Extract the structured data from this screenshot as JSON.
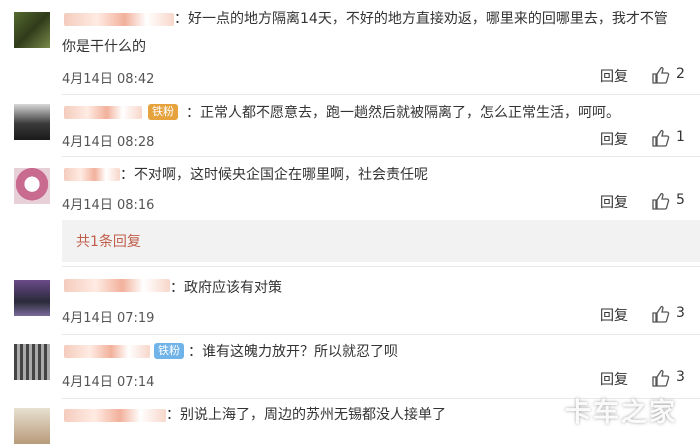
{
  "comments": [
    {
      "text_line1": "：好一点的地方隔离14天，不好的地方直接劝返，哪里来的回哪里去，我才不管",
      "text_line2": "你是干什么的",
      "date": "4月14日 08:42",
      "reply_label": "回复",
      "likes": "2"
    },
    {
      "badge": "铁粉",
      "text": "：正常人都不愿意去，跑一趟然后就被隔离了，怎么正常生活，呵呵。",
      "date": "4月14日 08:28",
      "reply_label": "回复",
      "likes": "1"
    },
    {
      "text": "：不对啊，这时候央企国企在哪里啊，社会责任呢",
      "date": "4月14日 08:16",
      "reply_label": "回复",
      "likes": "5",
      "subreplies_label": "共1条回复"
    },
    {
      "text": "：政府应该有对策",
      "date": "4月14日 07:19",
      "reply_label": "回复",
      "likes": "3"
    },
    {
      "badge": "铁粉",
      "text": "：谁有这魄力放开？所以就忍了呗",
      "date": "4月14日 07:14",
      "reply_label": "回复",
      "likes": "3"
    },
    {
      "text": "：别说上海了，周边的苏州无锡都没人接单了"
    }
  ],
  "watermark": "卡车之家",
  "colors": {
    "subreply_text": "#c05e4b",
    "badge_iron_fan_yellow": "#e6a23c",
    "badge_iron_fan_blue": "#6fb3e8"
  }
}
